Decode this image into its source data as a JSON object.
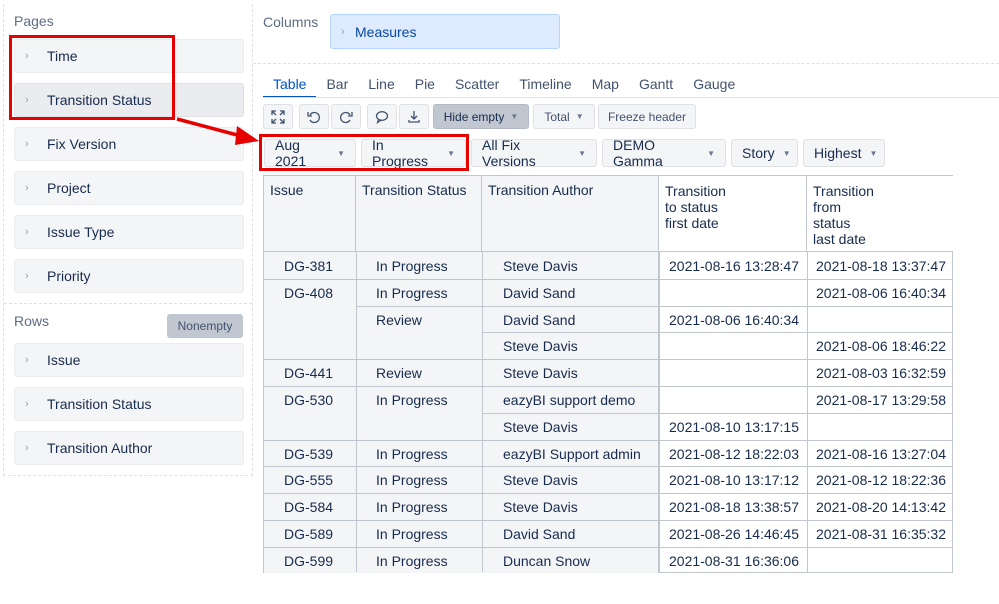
{
  "pages": {
    "title": "Pages",
    "items": [
      "Time",
      "Transition Status",
      "Fix Version",
      "Project",
      "Issue Type",
      "Priority"
    ]
  },
  "rows": {
    "title": "Rows",
    "nonempty_label": "Nonempty",
    "items": [
      "Issue",
      "Transition Status",
      "Transition Author"
    ]
  },
  "columns": {
    "title": "Columns",
    "measures_label": "Measures"
  },
  "tabs": [
    "Table",
    "Bar",
    "Line",
    "Pie",
    "Scatter",
    "Timeline",
    "Map",
    "Gantt",
    "Gauge"
  ],
  "toolbar": {
    "hide_empty": "Hide empty",
    "total": "Total",
    "freeze_header": "Freeze header"
  },
  "filters": [
    "Aug 2021",
    "In Progress",
    "All Fix Versions",
    "DEMO Gamma",
    "Story",
    "Highest"
  ],
  "table": {
    "headers": {
      "issue": "Issue",
      "status": "Transition Status",
      "author": "Transition Author",
      "to_status": [
        "Transition",
        "to status",
        "first date"
      ],
      "from_status": [
        "Transition",
        "from",
        "status",
        "last date"
      ]
    },
    "rows": [
      {
        "issue": "DG-381",
        "status": "In Progress",
        "author": "Steve Davis",
        "to": "2021-08-16 13:28:47",
        "from": "2021-08-18 13:37:47"
      },
      {
        "issue": "DG-408",
        "status": "In Progress",
        "author": "David Sand",
        "to": "",
        "from": "2021-08-06 16:40:34"
      },
      {
        "issue": "",
        "status": "Review",
        "author": "David Sand",
        "to": "2021-08-06 16:40:34",
        "from": ""
      },
      {
        "issue": "",
        "status": "",
        "author": "Steve Davis",
        "to": "",
        "from": "2021-08-06 18:46:22"
      },
      {
        "issue": "DG-441",
        "status": "Review",
        "author": "Steve Davis",
        "to": "",
        "from": "2021-08-03 16:32:59"
      },
      {
        "issue": "DG-530",
        "status": "In Progress",
        "author": "eazyBI support demo",
        "to": "",
        "from": "2021-08-17 13:29:58"
      },
      {
        "issue": "",
        "status": "",
        "author": "Steve Davis",
        "to": "2021-08-10 13:17:15",
        "from": ""
      },
      {
        "issue": "DG-539",
        "status": "In Progress",
        "author": "eazyBI Support admin",
        "to": "2021-08-12 18:22:03",
        "from": "2021-08-16 13:27:04"
      },
      {
        "issue": "DG-555",
        "status": "In Progress",
        "author": "Steve Davis",
        "to": "2021-08-10 13:17:12",
        "from": "2021-08-12 18:22:36"
      },
      {
        "issue": "DG-584",
        "status": "In Progress",
        "author": "Steve Davis",
        "to": "2021-08-18 13:38:57",
        "from": "2021-08-20 14:13:42"
      },
      {
        "issue": "DG-589",
        "status": "In Progress",
        "author": "David Sand",
        "to": "2021-08-26 14:46:45",
        "from": "2021-08-31 16:35:32"
      },
      {
        "issue": "DG-599",
        "status": "In Progress",
        "author": "Duncan Snow",
        "to": "2021-08-31 16:36:06",
        "from": ""
      }
    ]
  },
  "colors": {
    "accent": "#0052cc",
    "annotation": "#e60000",
    "measures_bg": "#deebff"
  }
}
